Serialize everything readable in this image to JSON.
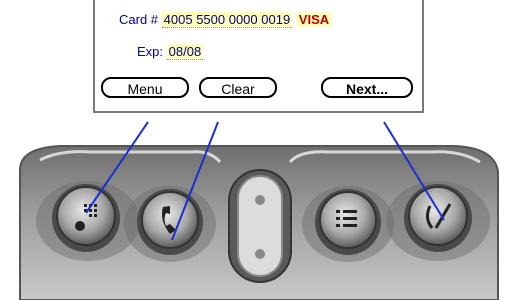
{
  "form": {
    "card_label": "Card #",
    "card_number": "4005 5500 0000 0019",
    "card_brand": "VISA",
    "exp_label": "Exp:",
    "exp_value": "08/08"
  },
  "buttons": {
    "menu": "Menu",
    "clear": "Clear",
    "next": "Next..."
  },
  "hardware_buttons": [
    {
      "icon": "calculator-icon"
    },
    {
      "icon": "phone-icon"
    },
    {
      "icon": "scroll-rocker"
    },
    {
      "icon": "menu-list-icon"
    },
    {
      "icon": "search-icon"
    }
  ],
  "colors": {
    "label_blue": "#0000a0",
    "field_yellow": "#ffffbf",
    "visa_red": "#c00000",
    "callout_line": "#1a2fd0",
    "device_gray": "#8c8c8c"
  }
}
